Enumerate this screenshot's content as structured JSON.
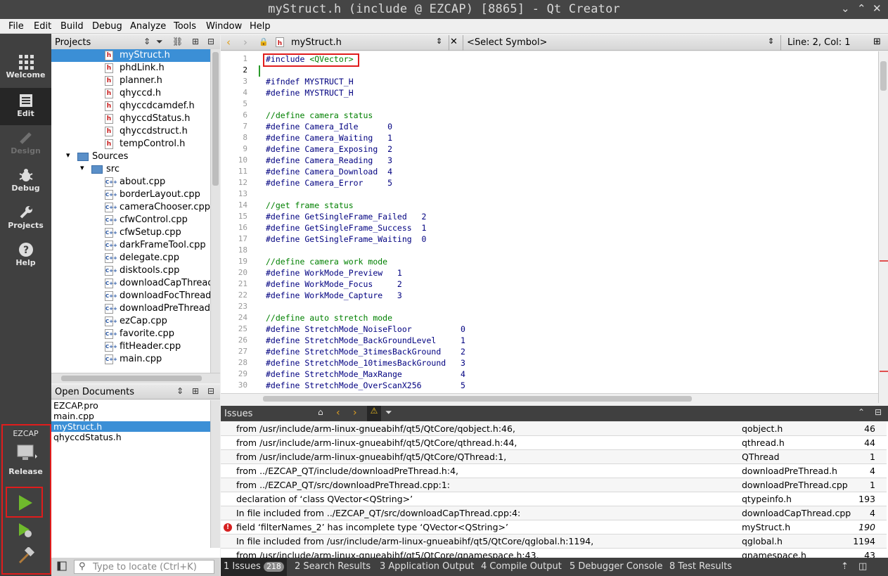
{
  "window": {
    "title": "myStruct.h (include @ EZCAP) [8865] - Qt Creator"
  },
  "menu": [
    "File",
    "Edit",
    "Build",
    "Debug",
    "Analyze",
    "Tools",
    "Window",
    "Help"
  ],
  "modes": {
    "welcome": "Welcome",
    "edit": "Edit",
    "design": "Design",
    "debug": "Debug",
    "projects": "Projects",
    "help": "Help"
  },
  "kit": {
    "project": "EZCAP",
    "config": "Release"
  },
  "projects_pane": {
    "title": "Projects",
    "items": [
      {
        "label": "myStruct.h",
        "type": "h",
        "selected": true
      },
      {
        "label": "phdLink.h",
        "type": "h"
      },
      {
        "label": "planner.h",
        "type": "h"
      },
      {
        "label": "qhyccd.h",
        "type": "h"
      },
      {
        "label": "qhyccdcamdef.h",
        "type": "h"
      },
      {
        "label": "qhyccdStatus.h",
        "type": "h"
      },
      {
        "label": "qhyccdstruct.h",
        "type": "h"
      },
      {
        "label": "tempControl.h",
        "type": "h"
      },
      {
        "label": "Sources",
        "type": "folder"
      },
      {
        "label": "src",
        "type": "subfolder"
      },
      {
        "label": "about.cpp",
        "type": "cpp"
      },
      {
        "label": "borderLayout.cpp",
        "type": "cpp"
      },
      {
        "label": "cameraChooser.cpp",
        "type": "cpp"
      },
      {
        "label": "cfwControl.cpp",
        "type": "cpp"
      },
      {
        "label": "cfwSetup.cpp",
        "type": "cpp"
      },
      {
        "label": "darkFrameTool.cpp",
        "type": "cpp"
      },
      {
        "label": "delegate.cpp",
        "type": "cpp"
      },
      {
        "label": "disktools.cpp",
        "type": "cpp"
      },
      {
        "label": "downloadCapThread.cpp",
        "type": "cpp"
      },
      {
        "label": "downloadFocThread.cpp",
        "type": "cpp"
      },
      {
        "label": "downloadPreThread.cpp",
        "type": "cpp"
      },
      {
        "label": "ezCap.cpp",
        "type": "cpp"
      },
      {
        "label": "favorite.cpp",
        "type": "cpp"
      },
      {
        "label": "fitHeader.cpp",
        "type": "cpp"
      },
      {
        "label": "main.cpp",
        "type": "cpp"
      }
    ]
  },
  "open_documents": {
    "title": "Open Documents",
    "items": [
      "EZCAP.pro",
      "main.cpp",
      "myStruct.h",
      "qhyccdStatus.h"
    ],
    "selected_index": 2
  },
  "locator": {
    "placeholder": "Type to locate (Ctrl+K)"
  },
  "editor_toolbar": {
    "file": "myStruct.h",
    "symbol": "<Select Symbol>",
    "position": "Line: 2, Col: 1"
  },
  "code": [
    {
      "n": "1",
      "parts": [
        [
          "pp",
          "#include "
        ],
        [
          "st",
          "<QVector>"
        ]
      ]
    },
    {
      "n": "2",
      "parts": []
    },
    {
      "n": "3",
      "parts": [
        [
          "pp",
          "#ifndef MYSTRUCT_H"
        ]
      ]
    },
    {
      "n": "4",
      "parts": [
        [
          "pp",
          "#define MYSTRUCT_H"
        ]
      ]
    },
    {
      "n": "5",
      "parts": []
    },
    {
      "n": "6",
      "parts": [
        [
          "cm",
          "//define camera status"
        ]
      ]
    },
    {
      "n": "7",
      "parts": [
        [
          "pp",
          "#define Camera_Idle      0"
        ]
      ]
    },
    {
      "n": "8",
      "parts": [
        [
          "pp",
          "#define Camera_Waiting   1"
        ]
      ]
    },
    {
      "n": "9",
      "parts": [
        [
          "pp",
          "#define Camera_Exposing  2"
        ]
      ]
    },
    {
      "n": "10",
      "parts": [
        [
          "pp",
          "#define Camera_Reading   3"
        ]
      ]
    },
    {
      "n": "11",
      "parts": [
        [
          "pp",
          "#define Camera_Download  4"
        ]
      ]
    },
    {
      "n": "12",
      "parts": [
        [
          "pp",
          "#define Camera_Error     5"
        ]
      ]
    },
    {
      "n": "13",
      "parts": []
    },
    {
      "n": "14",
      "parts": [
        [
          "cm",
          "//get frame status"
        ]
      ]
    },
    {
      "n": "15",
      "parts": [
        [
          "pp",
          "#define GetSingleFrame_Failed   2"
        ]
      ]
    },
    {
      "n": "16",
      "parts": [
        [
          "pp",
          "#define GetSingleFrame_Success  1"
        ]
      ]
    },
    {
      "n": "17",
      "parts": [
        [
          "pp",
          "#define GetSingleFrame_Waiting  0"
        ]
      ]
    },
    {
      "n": "18",
      "parts": []
    },
    {
      "n": "19",
      "parts": [
        [
          "cm",
          "//define camera work mode"
        ]
      ]
    },
    {
      "n": "20",
      "parts": [
        [
          "pp",
          "#define WorkMode_Preview   1"
        ]
      ]
    },
    {
      "n": "21",
      "parts": [
        [
          "pp",
          "#define WorkMode_Focus     2"
        ]
      ]
    },
    {
      "n": "22",
      "parts": [
        [
          "pp",
          "#define WorkMode_Capture   3"
        ]
      ]
    },
    {
      "n": "23",
      "parts": []
    },
    {
      "n": "24",
      "parts": [
        [
          "cm",
          "//define auto stretch mode"
        ]
      ]
    },
    {
      "n": "25",
      "parts": [
        [
          "pp",
          "#define StretchMode_NoiseFloor          0"
        ]
      ]
    },
    {
      "n": "26",
      "parts": [
        [
          "pp",
          "#define StretchMode_BackGroundLevel     1"
        ]
      ]
    },
    {
      "n": "27",
      "parts": [
        [
          "pp",
          "#define StretchMode_3timesBackGround    2"
        ]
      ]
    },
    {
      "n": "28",
      "parts": [
        [
          "pp",
          "#define StretchMode_10timesBackGround   3"
        ]
      ]
    },
    {
      "n": "29",
      "parts": [
        [
          "pp",
          "#define StretchMode_MaxRange            4"
        ]
      ]
    },
    {
      "n": "30",
      "parts": [
        [
          "pp",
          "#define StretchMode_OverScanX256        5"
        ]
      ]
    }
  ],
  "issues_pane": {
    "title": "Issues",
    "rows": [
      {
        "desc": "from /usr/include/arm-linux-gnueabihf/qt5/QtCore/qobject.h:46,",
        "file": "qobject.h",
        "line": "46"
      },
      {
        "desc": "from /usr/include/arm-linux-gnueabihf/qt5/QtCore/qthread.h:44,",
        "file": "qthread.h",
        "line": "44"
      },
      {
        "desc": "from /usr/include/arm-linux-gnueabihf/qt5/QtCore/QThread:1,",
        "file": "QThread",
        "line": "1"
      },
      {
        "desc": "from ../EZCAP_QT/include/downloadPreThread.h:4,",
        "file": "downloadPreThread.h",
        "line": "4"
      },
      {
        "desc": "from ../EZCAP_QT/src/downloadPreThread.cpp:1:",
        "file": "downloadPreThread.cpp",
        "line": "1"
      },
      {
        "desc": "declaration of ‘class QVector<QString>’",
        "file": "qtypeinfo.h",
        "line": "193"
      },
      {
        "desc": "In file included from ../EZCAP_QT/src/downloadCapThread.cpp:4:",
        "file": "downloadCapThread.cpp",
        "line": "4"
      },
      {
        "desc": "field ‘filterNames_2’ has incomplete type ‘QVector<QString>’",
        "file": "myStruct.h",
        "line": "190",
        "error": true
      },
      {
        "desc": "In file included from /usr/include/arm-linux-gnueabihf/qt5/QtCore/qglobal.h:1194,",
        "file": "qglobal.h",
        "line": "1194"
      },
      {
        "desc": "from /usr/include/arm-linux-gnueabihf/qt5/QtCore/qnamespace.h:43,",
        "file": "qnamespace.h",
        "line": "43"
      }
    ]
  },
  "output_tabs": [
    {
      "label": "1  Issues",
      "badge": "218"
    },
    {
      "label": "2  Search Results"
    },
    {
      "label": "3  Application Output"
    },
    {
      "label": "4  Compile Output"
    },
    {
      "label": "5  Debugger Console"
    },
    {
      "label": "8  Test Results"
    }
  ],
  "colors": {
    "selection": "#3b8fd6",
    "highlight_box": "#e01c1c",
    "preprocessor": "#000080",
    "comment": "#008000",
    "error": "#d62020"
  }
}
